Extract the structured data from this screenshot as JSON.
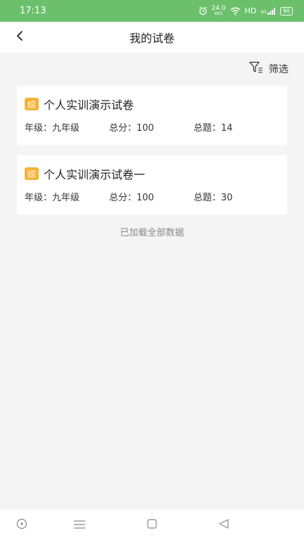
{
  "status_bar": {
    "time": "17:13",
    "net_speed": "24.0",
    "net_unit": "KB/S",
    "hd_label": "HD",
    "signal_label": "4G",
    "battery": "90"
  },
  "header": {
    "title": "我的试卷",
    "back_icon": "chevron-left-icon"
  },
  "filter": {
    "label": "筛选",
    "icon": "filter-icon"
  },
  "papers": [
    {
      "badge": "综",
      "title": "个人实训演示试卷",
      "grade": "年级：九年级",
      "total_score": "总分：100",
      "total_questions": "总题：14"
    },
    {
      "badge": "综",
      "title": "个人实训演示试卷一",
      "grade": "年级：九年级",
      "total_score": "总分：100",
      "total_questions": "总题：30"
    }
  ],
  "footer_note": "已加载全部数据",
  "colors": {
    "status_bar": "#6cc06c",
    "badge": "#f5b335",
    "background": "#f4f4f4"
  },
  "nav_icons": [
    "circle-dot-icon",
    "menu-icon",
    "square-icon",
    "triangle-back-icon"
  ]
}
